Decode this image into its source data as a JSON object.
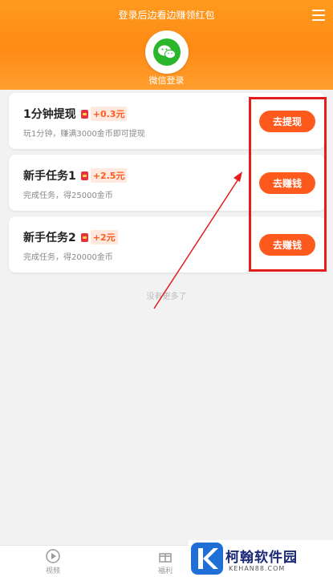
{
  "header": {
    "title": "登录后边看边赚领红包",
    "login_label": "微信登录"
  },
  "tasks": [
    {
      "title": "1分钟提现",
      "reward": "+0.3元",
      "desc": "玩1分钟，赚满3000金币即可提现",
      "button": "去提现"
    },
    {
      "title": "新手任务1",
      "reward": "+2.5元",
      "desc": "完成任务，得25000金币",
      "button": "去赚钱"
    },
    {
      "title": "新手任务2",
      "reward": "+2元",
      "desc": "完成任务，得20000金币",
      "button": "去赚钱"
    }
  ],
  "no_more": "没有更多了",
  "tabbar": {
    "video": "视频",
    "welfare": "福利"
  },
  "watermark": {
    "text": "柯翰软件园",
    "url": "KEHAN88.COM"
  },
  "colors": {
    "accent": "#ff5a1e",
    "header": "#ff8a16",
    "annotation": "#e41d1d"
  }
}
